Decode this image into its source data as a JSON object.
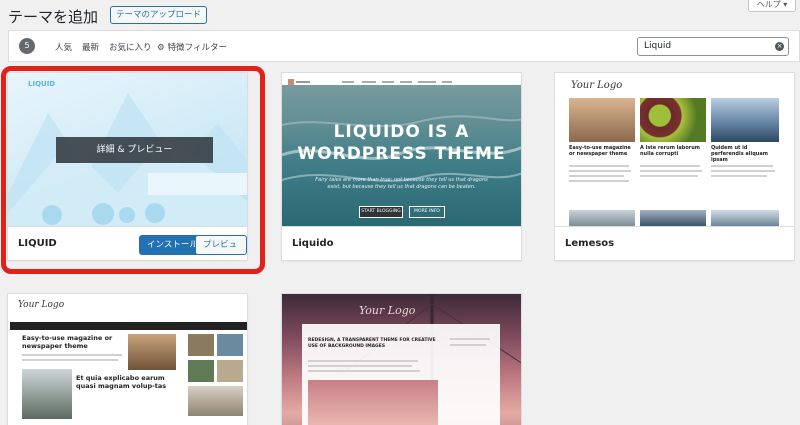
{
  "header": {
    "title": "テーマを追加",
    "upload_button": "テーマのアップロード",
    "help": "ヘルプ ▾"
  },
  "filter_bar": {
    "count": "5",
    "links": [
      "人気",
      "最新",
      "お気に入り"
    ],
    "feature_filter": "特徴フィルター",
    "search_value": "Liquid"
  },
  "themes": [
    {
      "name": "LIQUID",
      "details_label": "詳細 & プレビュー",
      "install_label": "インストール",
      "preview_label": "プレビュー",
      "logo_text": "LIQUID"
    },
    {
      "name": "Liquido",
      "hero_line1": "LIQUIDO IS A",
      "hero_line2": "WORDPRESS THEME",
      "hero_sub": "Fairy tales are more than true: not because they tell us that dragons exist, but because they tell us that dragons can be beaten.",
      "btn_start": "START BLOGGING",
      "btn_more": "MORE INFO"
    },
    {
      "name": "Lemesos",
      "logo": "Your Logo",
      "posts": [
        "Easy-to-use magazine or newspaper theme",
        "A iste rerum laborum nulla corrupti",
        "Quidem ut id perferendis aliquam ipsam"
      ]
    },
    {
      "name": "",
      "logo": "Your Logo",
      "headline1": "Easy-to-use magazine or newspaper theme",
      "headline2": "Et quia explicabo earum quasi magnam volup-tas"
    },
    {
      "name": "",
      "logo": "Your Logo",
      "post_title": "REDESIGN, A TRANSPARENT THEME FOR CREATIVE USE OF BACKGROUND IMAGES"
    }
  ],
  "colors": {
    "accent": "#2271b1",
    "highlight": "#e0221a"
  }
}
